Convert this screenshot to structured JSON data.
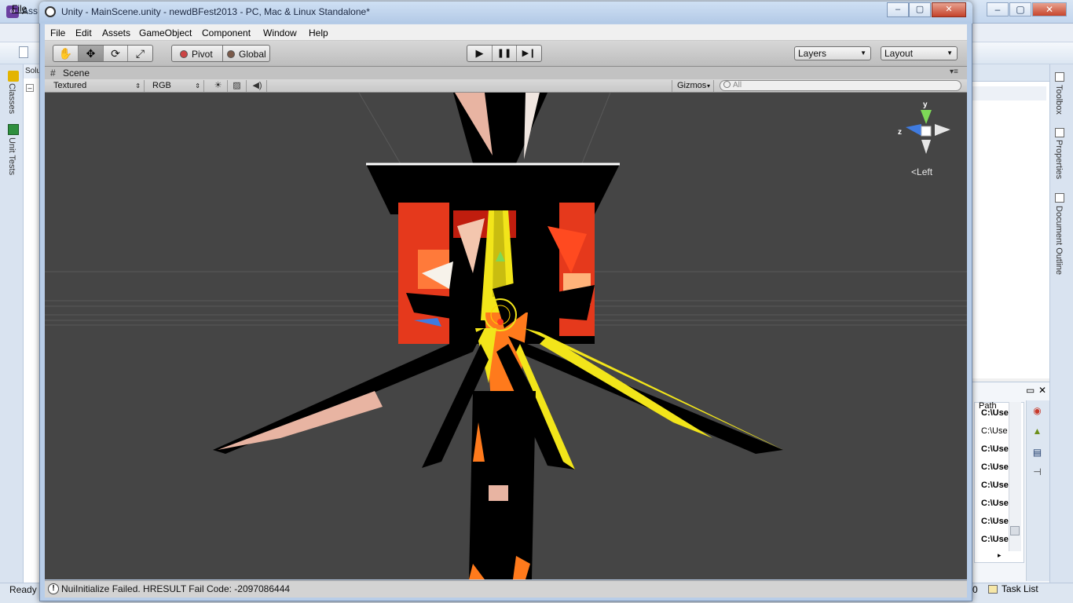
{
  "vs": {
    "title": "Ass",
    "menu_file": "File",
    "status_ready": "Ready",
    "status_zero": "0",
    "tasklist": "Task List",
    "left_tabs": [
      "Classes",
      "Unit Tests"
    ],
    "right_tabs": [
      "Toolbox",
      "Properties",
      "Document Outline"
    ],
    "solution_tab": "Solu",
    "path_header": "Path",
    "path_rows": [
      "C:\\Use",
      "C:\\Use",
      "C:\\Use",
      "C:\\Use",
      "C:\\Use",
      "C:\\Use",
      "C:\\Use",
      "C:\\Use"
    ]
  },
  "unity": {
    "title": "Unity - MainScene.unity - newdBFest2013 - PC, Mac & Linux Standalone*",
    "window_controls": {
      "minimize": "–",
      "maximize": "▢",
      "close": "✕"
    },
    "menu": [
      "File",
      "Edit",
      "Assets",
      "GameObject",
      "Component",
      "Window",
      "Help"
    ],
    "tools": {
      "hand": "✋",
      "move": "✥",
      "rotate": "⟳",
      "scale": "⤢"
    },
    "pivot_label": "Pivot",
    "global_label": "Global",
    "play": {
      "play": "▶",
      "pause": "❚❚",
      "step": "▶❙"
    },
    "layers_label": "Layers",
    "layout_label": "Layout",
    "scene_tab_label": "Scene",
    "scene_options": {
      "draw_mode": "Textured",
      "render_mode": "RGB",
      "gizmos_label": "Gizmos",
      "search_placeholder": "All"
    },
    "gizmo": {
      "y": "y",
      "z": "z",
      "view_label": "Left"
    },
    "status_message": "NuiInitialize Failed. HRESULT Fail Code: -2097086444"
  },
  "colors": {
    "scene_bg": "#454545",
    "unity_toolbar": "#c8c8c8",
    "gizmo_y": "#7ed957",
    "gizmo_z": "#3f7be0",
    "mesh_black": "#000000",
    "mesh_yellow": "#f2e51a",
    "mesh_red": "#e5391c",
    "mesh_pink": "#e8b4a2"
  }
}
